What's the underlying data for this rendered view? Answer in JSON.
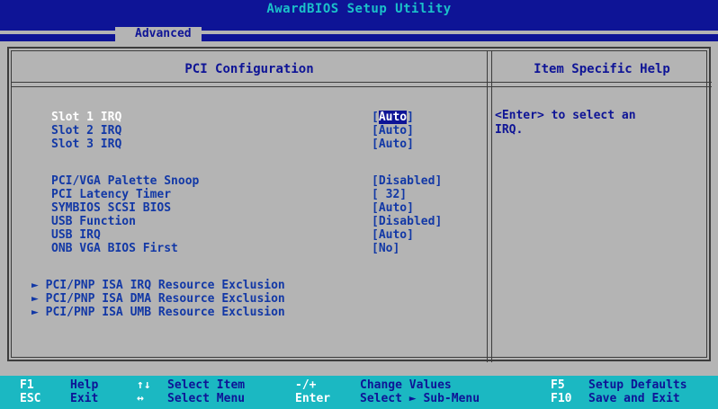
{
  "header": {
    "title": "AwardBIOS Setup Utility",
    "active_tab": "Advanced"
  },
  "panel": {
    "title": "PCI Configuration",
    "help_title": "Item Specific Help",
    "help_text": "<Enter> to select an\nIRQ."
  },
  "settings": [
    {
      "label": "Slot 1 IRQ",
      "value_open": "[",
      "value": "Auto",
      "value_close": "]"
    },
    {
      "label": "Slot 2 IRQ",
      "value": "[Auto]"
    },
    {
      "label": "Slot 3 IRQ",
      "value": "[Auto]"
    },
    {
      "label": "PCI/VGA Palette Snoop",
      "value": "[Disabled]"
    },
    {
      "label": "PCI Latency Timer",
      "value": "[ 32]"
    },
    {
      "label": "SYMBIOS SCSI BIOS",
      "value": "[Auto]"
    },
    {
      "label": "USB Function",
      "value": "[Disabled]"
    },
    {
      "label": "USB IRQ",
      "value": "[Auto]"
    },
    {
      "label": "ONB VGA BIOS First",
      "value": "[No]"
    }
  ],
  "submenus": [
    "PCI/PNP ISA IRQ Resource Exclusion",
    "PCI/PNP ISA DMA Resource Exclusion",
    "PCI/PNP ISA UMB Resource Exclusion"
  ],
  "submenu_marker": "►",
  "keys": [
    {
      "key": "F1",
      "desc": "Help"
    },
    {
      "key": "ESC",
      "desc": "Exit"
    },
    {
      "key": "↑↓",
      "desc": "Select Item"
    },
    {
      "key": "↔",
      "desc": "Select Menu"
    },
    {
      "key": "-/+",
      "desc": "Change Values"
    },
    {
      "key": "Enter",
      "desc": "Select ► Sub-Menu"
    },
    {
      "key": "F5",
      "desc": "Setup Defaults"
    },
    {
      "key": "F10",
      "desc": "Save and Exit"
    }
  ],
  "colors": {
    "background": "#b4b4b4",
    "title_bar": "#0e1496",
    "title_text": "#1bc1c9",
    "item_text": "#1238a6",
    "selected_text": "#ffffff",
    "key_bar": "#1bb8c2"
  }
}
